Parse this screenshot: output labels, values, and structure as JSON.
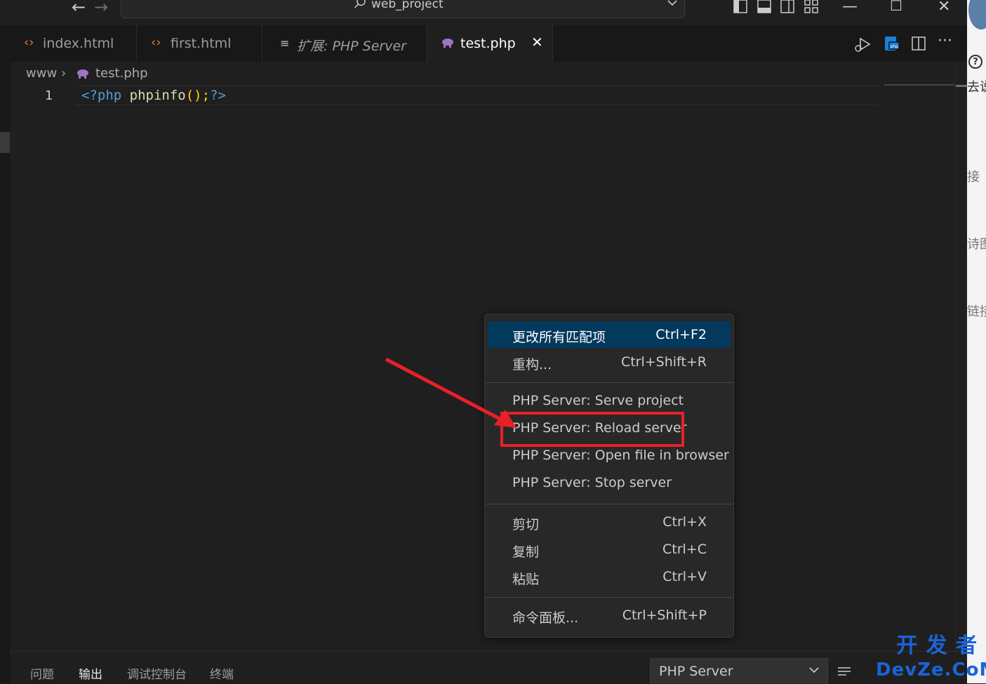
{
  "titlebar": {
    "back_icon": "arrow-left-icon",
    "forward_icon": "arrow-right-icon",
    "search_text": "web_project",
    "layout_icons": [
      "toggle-sidebar-icon",
      "toggle-panel-icon",
      "toggle-secondary-sidebar-icon",
      "customize-layout-icon"
    ],
    "window_controls": [
      "minimize-icon",
      "maximize-icon",
      "close-icon"
    ]
  },
  "tabs": [
    {
      "label": "index.html",
      "icon": "html-icon",
      "active": false,
      "italic": false
    },
    {
      "label": "first.html",
      "icon": "html-icon",
      "active": false,
      "italic": false
    },
    {
      "label": "扩展: PHP Server",
      "icon": "extension-preview-icon",
      "active": false,
      "italic": true
    },
    {
      "label": "test.php",
      "icon": "php-elephant-icon",
      "active": true,
      "italic": false
    }
  ],
  "breadcrumb": {
    "folder": "www",
    "file": "test.php"
  },
  "editor": {
    "line_number": "1",
    "code_open": "<?php",
    "code_func": "phpinfo",
    "code_punct": "();",
    "code_close": "?>"
  },
  "context_menu": {
    "groups": [
      [
        {
          "label": "更改所有匹配项",
          "shortcut": "Ctrl+F2",
          "selected": true
        },
        {
          "label": "重构...",
          "shortcut": "Ctrl+Shift+R",
          "selected": false
        }
      ],
      [
        {
          "label": "PHP Server: Serve project",
          "shortcut": "",
          "selected": false
        },
        {
          "label": "PHP Server: Reload server",
          "shortcut": "",
          "selected": false,
          "highlighted": true
        },
        {
          "label": "PHP Server: Open file in browser",
          "shortcut": "",
          "selected": false
        },
        {
          "label": "PHP Server: Stop server",
          "shortcut": "",
          "selected": false
        }
      ],
      [
        {
          "label": "剪切",
          "shortcut": "Ctrl+X",
          "selected": false
        },
        {
          "label": "复制",
          "shortcut": "Ctrl+C",
          "selected": false
        },
        {
          "label": "粘贴",
          "shortcut": "Ctrl+V",
          "selected": false
        }
      ],
      [
        {
          "label": "命令面板...",
          "shortcut": "Ctrl+Shift+P",
          "selected": false
        }
      ]
    ]
  },
  "panel": {
    "tabs": [
      "问题",
      "输出",
      "调试控制台",
      "终端"
    ],
    "active_tab": "输出",
    "output_channel": "PHP Server"
  },
  "outer_window_fragments": [
    "去说",
    "接",
    "诗图",
    "链接"
  ],
  "watermark": {
    "line1": "开 发 者",
    "line2": "DevZe.CoM"
  },
  "colors": {
    "accent_selected": "#04395e",
    "annotation_red": "#e8202a",
    "php_keyword": "#569cd6",
    "php_function": "#dcdcaa",
    "html_icon": "#e37933",
    "php_icon": "#a074c4"
  }
}
